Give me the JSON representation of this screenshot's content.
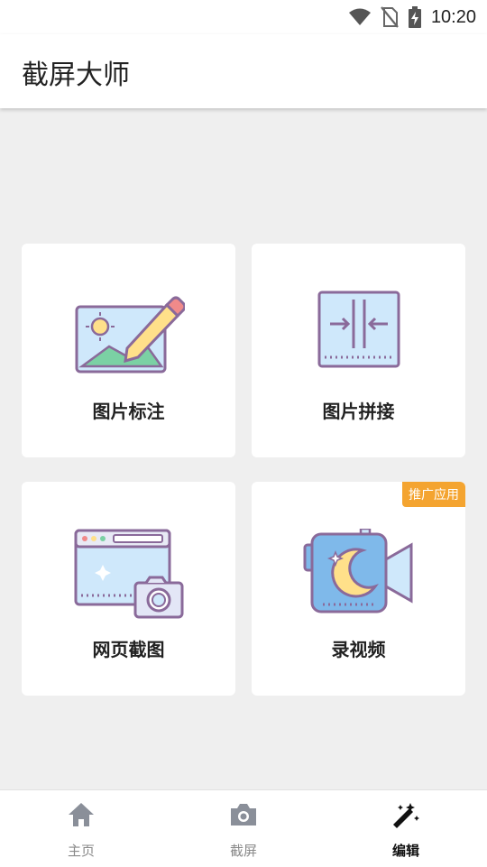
{
  "status_bar": {
    "time": "10:20",
    "icons": [
      "wifi-icon",
      "no-sim-icon",
      "battery-charging-icon"
    ]
  },
  "app_bar": {
    "title": "截屏大师"
  },
  "cards": [
    {
      "label": "图片标注",
      "icon": "image-annotate-icon"
    },
    {
      "label": "图片拼接",
      "icon": "image-stitch-icon"
    },
    {
      "label": "网页截图",
      "icon": "webpage-screenshot-icon"
    },
    {
      "label": "录视频",
      "icon": "record-video-icon",
      "badge": "推广应用"
    }
  ],
  "bottom_nav": {
    "items": [
      {
        "label": "主页",
        "icon": "home-icon",
        "active": false
      },
      {
        "label": "截屏",
        "icon": "camera-icon",
        "active": false
      },
      {
        "label": "编辑",
        "icon": "magic-wand-icon",
        "active": true
      }
    ]
  },
  "colors": {
    "background": "#efefef",
    "card": "#ffffff",
    "badge": "#f4a430",
    "icon_outline": "#8a6a9a",
    "icon_fill": "#cfe8fb"
  }
}
